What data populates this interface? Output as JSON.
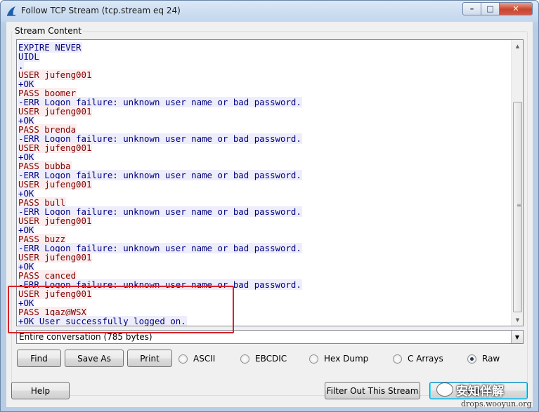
{
  "window": {
    "title": "Follow TCP Stream (tcp.stream eq 24)",
    "controls": {
      "minimize": "–",
      "maximize": "□",
      "close": "✕"
    }
  },
  "group": {
    "label": "Stream Content"
  },
  "stream": {
    "lines": [
      {
        "text": "EXPIRE NEVER",
        "dir": "server"
      },
      {
        "text": "UIDL",
        "dir": "server"
      },
      {
        "text": ".",
        "dir": "server"
      },
      {
        "text": "USER jufeng001",
        "dir": "client"
      },
      {
        "text": "+OK",
        "dir": "server"
      },
      {
        "text": "PASS boomer",
        "dir": "client"
      },
      {
        "text": "-ERR Logon failure: unknown user name or bad password.",
        "dir": "server"
      },
      {
        "text": "USER jufeng001",
        "dir": "client"
      },
      {
        "text": "+OK",
        "dir": "server"
      },
      {
        "text": "PASS brenda",
        "dir": "client"
      },
      {
        "text": "-ERR Logon failure: unknown user name or bad password.",
        "dir": "server"
      },
      {
        "text": "USER jufeng001",
        "dir": "client"
      },
      {
        "text": "+OK",
        "dir": "server"
      },
      {
        "text": "PASS bubba",
        "dir": "client"
      },
      {
        "text": "-ERR Logon failure: unknown user name or bad password.",
        "dir": "server"
      },
      {
        "text": "USER jufeng001",
        "dir": "client"
      },
      {
        "text": "+OK",
        "dir": "server"
      },
      {
        "text": "PASS bull",
        "dir": "client"
      },
      {
        "text": "-ERR Logon failure: unknown user name or bad password.",
        "dir": "server"
      },
      {
        "text": "USER jufeng001",
        "dir": "client"
      },
      {
        "text": "+OK",
        "dir": "server"
      },
      {
        "text": "PASS buzz",
        "dir": "client"
      },
      {
        "text": "-ERR Logon failure: unknown user name or bad password.",
        "dir": "server"
      },
      {
        "text": "USER jufeng001",
        "dir": "client"
      },
      {
        "text": "+OK",
        "dir": "server"
      },
      {
        "text": "PASS canced",
        "dir": "client"
      },
      {
        "text": "-ERR Logon failure: unknown user name or bad password.",
        "dir": "server"
      },
      {
        "text": "USER jufeng001",
        "dir": "client"
      },
      {
        "text": "+OK",
        "dir": "server"
      },
      {
        "text": "PASS 1qaz@WSX",
        "dir": "client"
      },
      {
        "text": "+OK User successfully logged on.",
        "dir": "server"
      }
    ],
    "colors": {
      "client_text": "#800000",
      "server_text": "#000080",
      "highlight_box": "#d6232a"
    }
  },
  "conversation_select": {
    "value": "Entire conversation (785 bytes)"
  },
  "buttons": {
    "find": {
      "label": "Find"
    },
    "save_as": {
      "label": "Save As"
    },
    "print": {
      "label": "Print"
    },
    "help": {
      "label": "Help"
    },
    "filter_out": {
      "label": "Filter Out This Stream"
    },
    "close": {
      "label": "Close"
    }
  },
  "format_options": [
    {
      "label": "ASCII",
      "checked": false
    },
    {
      "label": "EBCDIC",
      "checked": false
    },
    {
      "label": "Hex Dump",
      "checked": false
    },
    {
      "label": "C Arrays",
      "checked": false
    },
    {
      "label": "Raw",
      "checked": true
    }
  ],
  "watermark": {
    "text": "安知伴解",
    "url": "drops.wooyun.org"
  }
}
